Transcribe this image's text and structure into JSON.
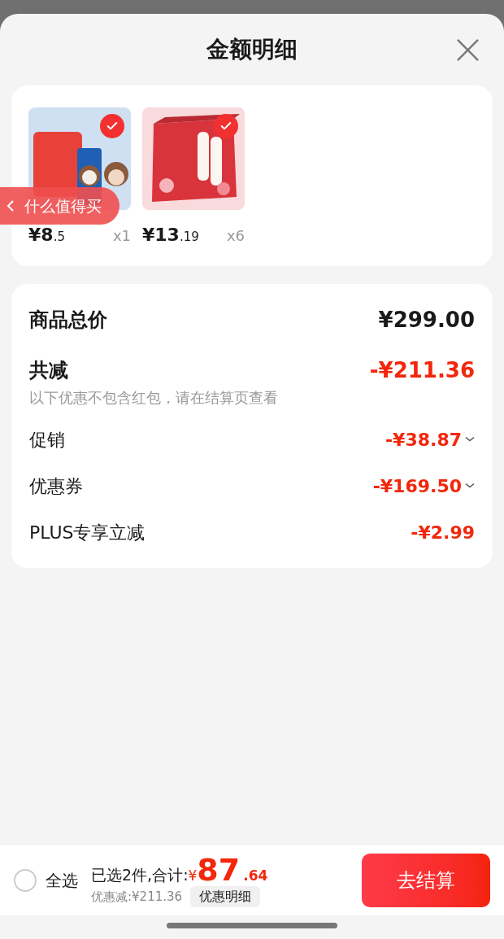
{
  "sheet": {
    "title": "金额明细"
  },
  "products": [
    {
      "price_main": "¥8",
      "price_decimal": ".5",
      "quantity": "x1",
      "checked": true
    },
    {
      "price_main": "¥13",
      "price_decimal": ".19",
      "quantity": "x6",
      "checked": true
    }
  ],
  "floating_tab": {
    "label": "什么值得买"
  },
  "summary": {
    "total_label": "商品总价",
    "total_value": "¥299.00",
    "reduced_label": "共减",
    "reduced_value": "-¥211.36",
    "note": "以下优惠不包含红包，请在结算页查看",
    "items": [
      {
        "label": "促销",
        "value": "-¥38.87",
        "expandable": true
      },
      {
        "label": "优惠券",
        "value": "-¥169.50",
        "expandable": true
      },
      {
        "label": "PLUS专享立减",
        "value": "-¥2.99",
        "expandable": false
      }
    ]
  },
  "bottom_bar": {
    "select_all_label": "全选",
    "select_all_checked": false,
    "selected_text": "已选2件,合计:",
    "currency": "¥",
    "amount_main": "87",
    "amount_decimal": ".64",
    "discount_text": "优惠减:¥211.36",
    "detail_button": "优惠明细",
    "checkout_button": "去结算"
  }
}
